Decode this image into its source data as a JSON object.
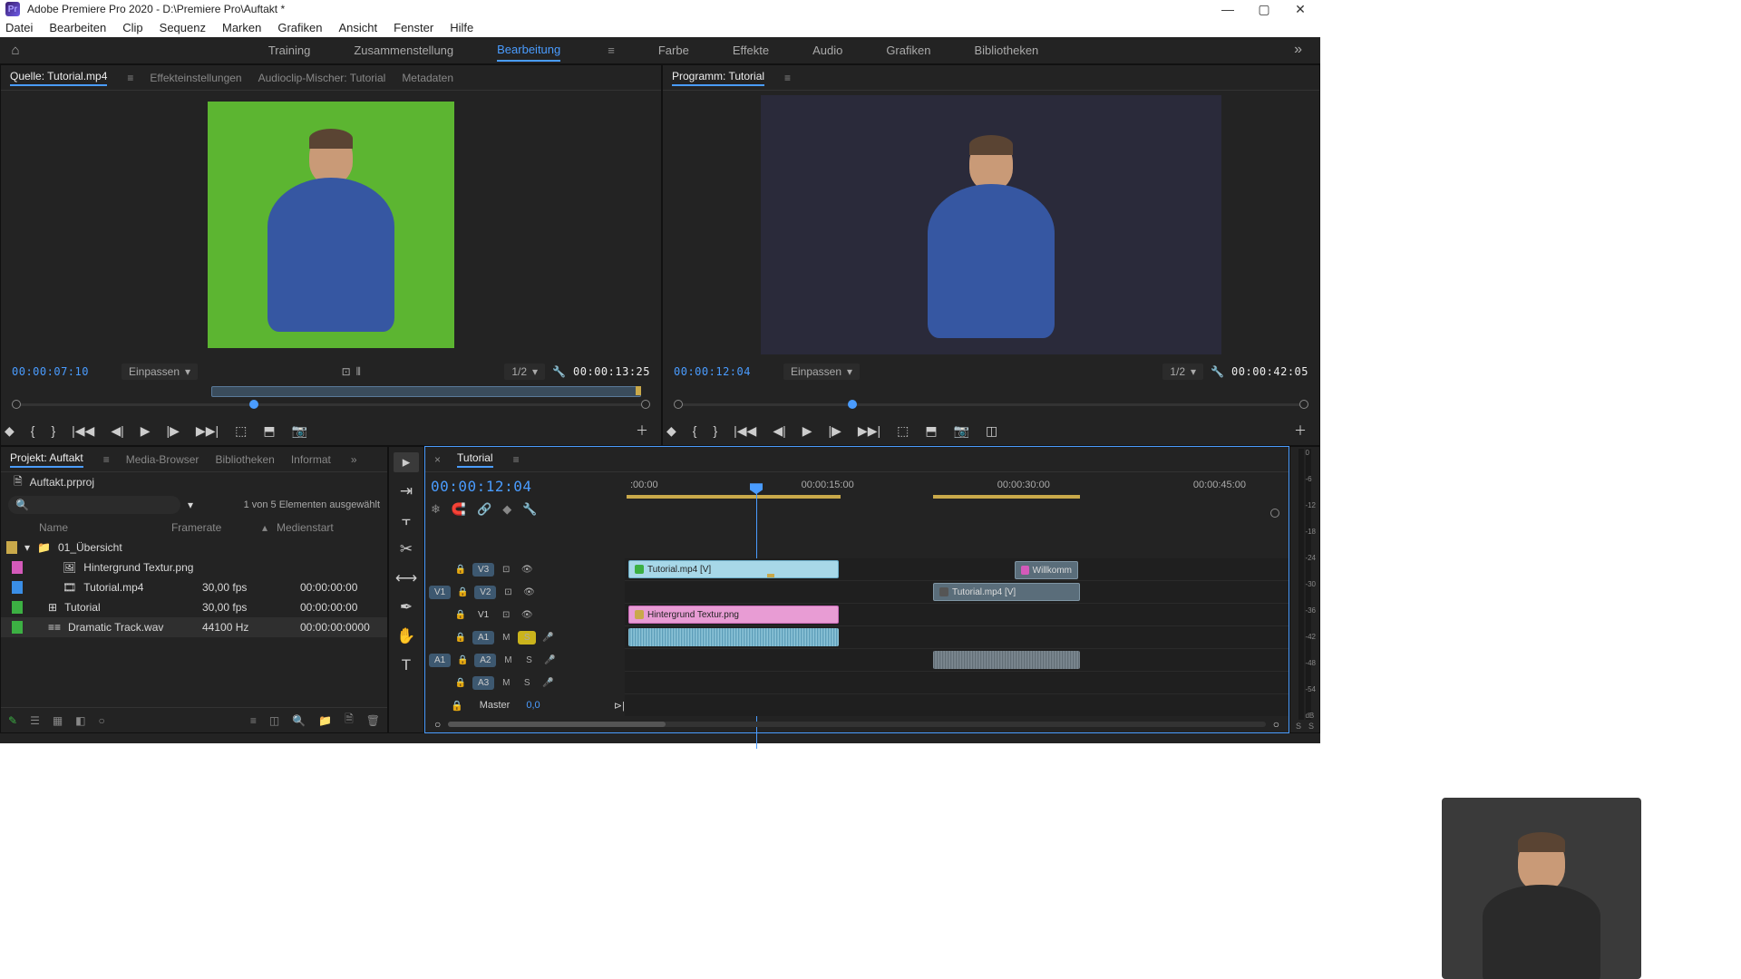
{
  "title": "Adobe Premiere Pro 2020 - D:\\Premiere Pro\\Auftakt *",
  "menu": [
    "Datei",
    "Bearbeiten",
    "Clip",
    "Sequenz",
    "Marken",
    "Grafiken",
    "Ansicht",
    "Fenster",
    "Hilfe"
  ],
  "workspaces": [
    "Training",
    "Zusammenstellung",
    "Bearbeitung",
    "Farbe",
    "Effekte",
    "Audio",
    "Grafiken",
    "Bibliotheken"
  ],
  "active_workspace": "Bearbeitung",
  "source": {
    "tabs": [
      "Quelle: Tutorial.mp4",
      "Effekteinstellungen",
      "Audioclip-Mischer: Tutorial",
      "Metadaten"
    ],
    "time_current": "00:00:07:10",
    "fit": "Einpassen",
    "zoom": "1/2",
    "time_total": "00:00:13:25"
  },
  "program": {
    "tab": "Programm: Tutorial",
    "time_current": "00:00:12:04",
    "fit": "Einpassen",
    "zoom": "1/2",
    "time_total": "00:00:42:05"
  },
  "project": {
    "tabs": [
      "Projekt: Auftakt",
      "Media-Browser",
      "Bibliotheken",
      "Informat"
    ],
    "file": "Auftakt.prproj",
    "selection": "1 von 5 Elementen ausgewählt",
    "columns": [
      "Name",
      "Framerate",
      "Medienstart"
    ],
    "items": [
      {
        "color": "#c9a94a",
        "name": "01_Übersicht",
        "fr": "",
        "ms": "",
        "type": "bin"
      },
      {
        "color": "#d45aba",
        "name": "Hintergrund Textur.png",
        "fr": "",
        "ms": "",
        "type": "image"
      },
      {
        "color": "#3a8ee6",
        "name": "Tutorial.mp4",
        "fr": "30,00 fps",
        "ms": "00:00:00:00",
        "type": "video"
      },
      {
        "color": "#3cb043",
        "name": "Tutorial",
        "fr": "30,00 fps",
        "ms": "00:00:00:00",
        "type": "seq"
      },
      {
        "color": "#3cb043",
        "name": "Dramatic Track.wav",
        "fr": "44100 Hz",
        "ms": "00:00:00:0000",
        "type": "audio"
      }
    ]
  },
  "timeline": {
    "tab": "Tutorial",
    "time": "00:00:12:04",
    "ruler": [
      ":00:00",
      "00:00:15:00",
      "00:00:30:00",
      "00:00:45:00"
    ],
    "tracks_video": [
      "V3",
      "V2",
      "V1"
    ],
    "tracks_audio": [
      "A1",
      "A2",
      "A3"
    ],
    "master": "Master",
    "master_val": "0,0",
    "clips": {
      "v3": {
        "label": "Tutorial.mp4 [V]"
      },
      "v2_a": {
        "label": "Tutorial.mp4 [V]"
      },
      "v2_b": {
        "label": "Willkomm"
      },
      "v1": {
        "label": "Hintergrund Textur.png"
      }
    }
  },
  "audio_meter_labels": [
    "0",
    "-6",
    "-12",
    "-18",
    "-24",
    "-30",
    "-36",
    "-42",
    "-48",
    "-54",
    "dB"
  ]
}
